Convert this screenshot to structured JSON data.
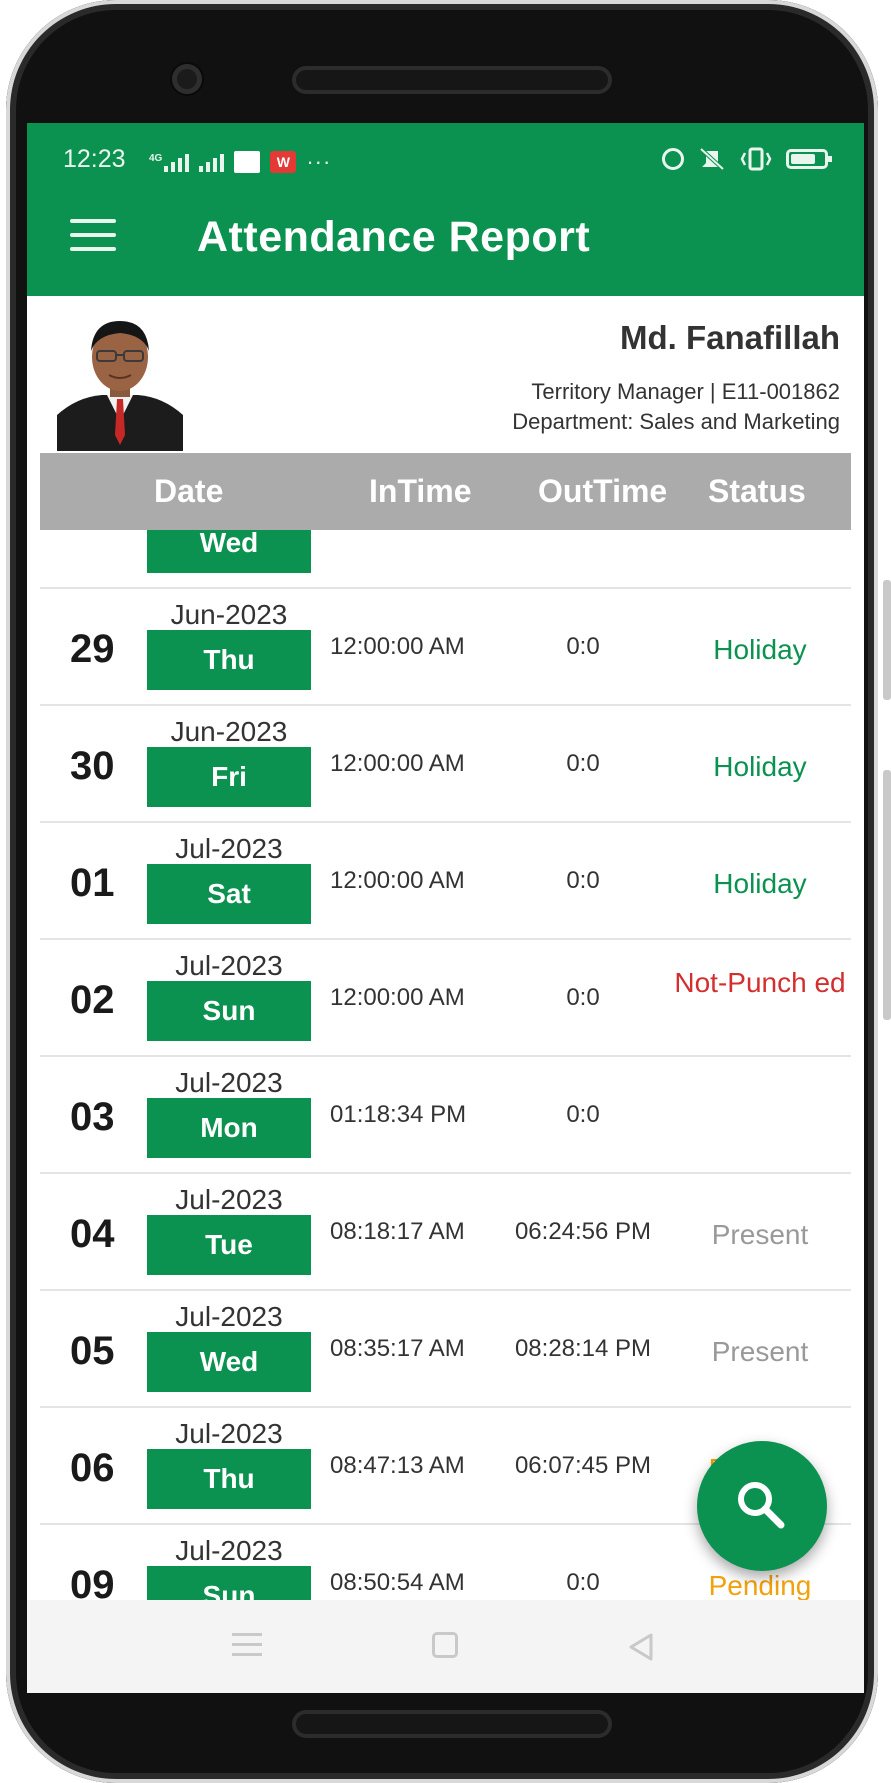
{
  "status_bar": {
    "time": "12:23",
    "network_label": "4G",
    "icons_left": [
      "signal-4g-icon",
      "signal-icon",
      "app-notification-icon",
      "wps-icon",
      "more-dots-icon"
    ],
    "icons_right": [
      "ring-icon",
      "silent-icon",
      "vibrate-icon",
      "battery-icon"
    ],
    "wps_label": "W",
    "more": "···"
  },
  "app_bar": {
    "title": "Attendance Report",
    "color": "#0b9150"
  },
  "employee": {
    "name": "Md. Fanafillah",
    "designation_line": "Territory Manager | E11-001862",
    "department_line": "Department: Sales and Marketing"
  },
  "table": {
    "headers": {
      "date": "Date",
      "in_time": "InTime",
      "out_time": "OutTime",
      "status": "Status"
    },
    "partial_top_row": {
      "weekday": "Wed"
    },
    "rows": [
      {
        "day": "29",
        "month": "Jun-2023",
        "weekday": "Thu",
        "in_time": "12:00:00 AM",
        "out_time": "0:0",
        "status": "Holiday",
        "status_color": "#0b9150"
      },
      {
        "day": "30",
        "month": "Jun-2023",
        "weekday": "Fri",
        "in_time": "12:00:00 AM",
        "out_time": "0:0",
        "status": "Holiday",
        "status_color": "#0b9150"
      },
      {
        "day": "01",
        "month": "Jul-2023",
        "weekday": "Sat",
        "in_time": "12:00:00 AM",
        "out_time": "0:0",
        "status": "Holiday",
        "status_color": "#0b9150"
      },
      {
        "day": "02",
        "month": "Jul-2023",
        "weekday": "Sun",
        "in_time": "12:00:00 AM",
        "out_time": "0:0",
        "status": "Not-Punch ed",
        "status_color": "#d32f2f"
      },
      {
        "day": "03",
        "month": "Jul-2023",
        "weekday": "Mon",
        "in_time": "01:18:34 PM",
        "out_time": "0:0",
        "status": "",
        "status_color": "#888888"
      },
      {
        "day": "04",
        "month": "Jul-2023",
        "weekday": "Tue",
        "in_time": "08:18:17 AM",
        "out_time": "06:24:56 PM",
        "status": "Present",
        "status_color": "#999999"
      },
      {
        "day": "05",
        "month": "Jul-2023",
        "weekday": "Wed",
        "in_time": "08:35:17 AM",
        "out_time": "08:28:14 PM",
        "status": "Present",
        "status_color": "#999999"
      },
      {
        "day": "06",
        "month": "Jul-2023",
        "weekday": "Thu",
        "in_time": "08:47:13 AM",
        "out_time": "06:07:45 PM",
        "status": "Pending",
        "status_color": "#f2a20c"
      },
      {
        "day": "09",
        "month": "Jul-2023",
        "weekday": "Sun",
        "in_time": "08:50:54 AM",
        "out_time": "0:0",
        "status": "Pending",
        "status_color": "#f2a20c"
      }
    ]
  },
  "fab": {
    "icon": "search-icon"
  },
  "nav_bar": {
    "icons": [
      "recent-apps-icon",
      "home-icon",
      "back-icon"
    ]
  }
}
